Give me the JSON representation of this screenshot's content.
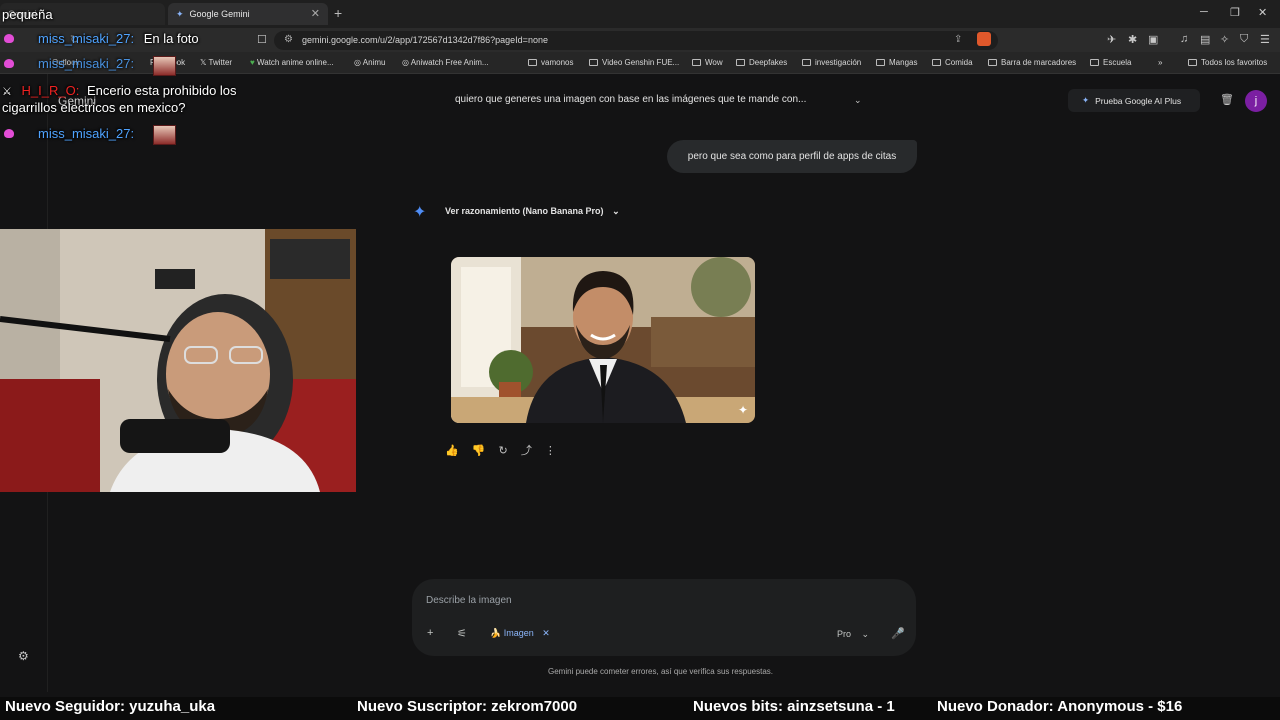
{
  "browser": {
    "tab_inactive": "Gemini",
    "tab_active": "Google Gemini",
    "url": "gemini.google.com/u/2/app/172567d1342d7f86?pageId=none",
    "bookmarks": [
      "Outlook",
      "Facebook",
      "Twitter",
      "Watch anime online...",
      "Animu",
      "Aniwatch Free Anim...",
      "vamonos",
      "Video Genshin FUE...",
      "Wow",
      "Deepfakes",
      "investigación",
      "Mangas",
      "Comida",
      "Barra de marcadores",
      "Escuela",
      "Todos los favoritos"
    ]
  },
  "gemini": {
    "app_name": "Gemini",
    "conversation_title": "quiero que generes una imagen con base en las imágenes que te mande con...",
    "upgrade_label": "Prueba Google AI Plus",
    "avatar_letter": "j",
    "user_message": "pero que sea como para perfil de apps de citas",
    "reasoning_label": "Ver razonamiento (Nano Banana Pro)",
    "input_placeholder": "Describe la imagen",
    "tool_chip": "Imagen",
    "model_label": "Pro",
    "disclaimer": "Gemini puede cometer errores, así que verifica sus respuestas."
  },
  "stream_chat": [
    {
      "user": "",
      "text": "pequeña"
    },
    {
      "user": "miss_misaki_27:",
      "text": "En la foto"
    },
    {
      "user": "miss_misaki_27:",
      "text": ""
    },
    {
      "user": "H_I_R_O:",
      "text": "Encerio esta prohibido los"
    },
    {
      "user": "",
      "text": "cigarrillos electricos en mexico?"
    },
    {
      "user": "miss_misaki_27:",
      "text": ""
    }
  ],
  "ticker": {
    "follower": "Nuevo Seguidor: yuzuha_uka",
    "subscriber": "Nuevo Suscriptor: zekrom7000",
    "bits": "Nuevos bits: ainzsetsuna - 1",
    "donor": "Nuevo Donador: Anonymous - $16"
  },
  "colors": {
    "background": "#131314",
    "accent": "#8ab4f8",
    "gemini_star": "#4f8df5",
    "avatar": "#7b1fa2",
    "chat_username": "#4fa3ff"
  }
}
